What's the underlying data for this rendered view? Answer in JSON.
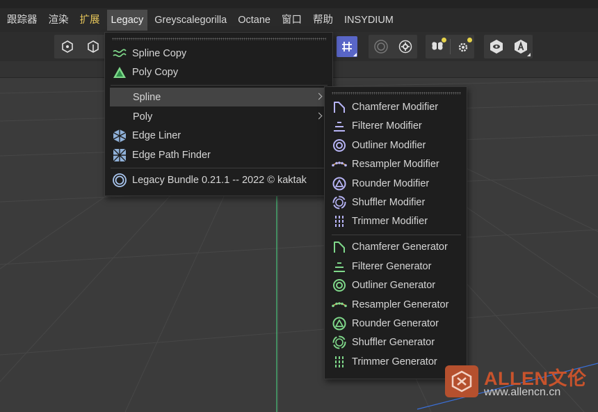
{
  "menubar": {
    "items": [
      {
        "label": "跟踪器"
      },
      {
        "label": "渲染"
      },
      {
        "label": "扩展"
      },
      {
        "label": "Legacy"
      },
      {
        "label": "Greyscalegorilla"
      },
      {
        "label": "Octane"
      },
      {
        "label": "窗口"
      },
      {
        "label": "帮助"
      },
      {
        "label": "INSYDIUM"
      }
    ]
  },
  "legacy_menu": {
    "items": [
      {
        "label": "Spline Copy",
        "icon": "spline-copy-icon"
      },
      {
        "label": "Poly Copy",
        "icon": "poly-copy-icon"
      },
      {
        "label": "Spline",
        "has_submenu": true
      },
      {
        "label": "Poly",
        "has_submenu": true
      },
      {
        "label": "Edge Liner",
        "icon": "edge-liner-icon"
      },
      {
        "label": "Edge Path Finder",
        "icon": "edge-path-finder-icon"
      },
      {
        "label": "Legacy Bundle 0.21.1 -- 2022 © kaktak",
        "icon": "legacy-bundle-icon"
      }
    ]
  },
  "spline_submenu": {
    "modifiers": [
      {
        "label": "Chamferer Modifier",
        "icon": "chamferer-icon"
      },
      {
        "label": "Filterer Modifier",
        "icon": "filterer-icon"
      },
      {
        "label": "Outliner Modifier",
        "icon": "outliner-icon"
      },
      {
        "label": "Resampler Modifier",
        "icon": "resampler-icon"
      },
      {
        "label": "Rounder Modifier",
        "icon": "rounder-icon"
      },
      {
        "label": "Shuffler Modifier",
        "icon": "shuffler-icon"
      },
      {
        "label": "Trimmer Modifier",
        "icon": "trimmer-icon"
      }
    ],
    "generators": [
      {
        "label": "Chamferer Generator",
        "icon": "chamferer-icon"
      },
      {
        "label": "Filterer Generator",
        "icon": "filterer-icon"
      },
      {
        "label": "Outliner Generator",
        "icon": "outliner-icon"
      },
      {
        "label": "Resampler Generator",
        "icon": "resampler-icon"
      },
      {
        "label": "Rounder Generator",
        "icon": "rounder-icon"
      },
      {
        "label": "Shuffler Generator",
        "icon": "shuffler-icon"
      },
      {
        "label": "Trimmer Generator",
        "icon": "trimmer-icon"
      }
    ]
  },
  "watermark": {
    "title": "ALLEN文伦",
    "url": "www.allencn.cn"
  },
  "colors": {
    "modifier_accent": "#b7b4f5",
    "generator_accent": "#7fd88a",
    "highlight": "#444444",
    "menu_gold": "#e7c65a",
    "watermark_orange": "#c8532c"
  }
}
